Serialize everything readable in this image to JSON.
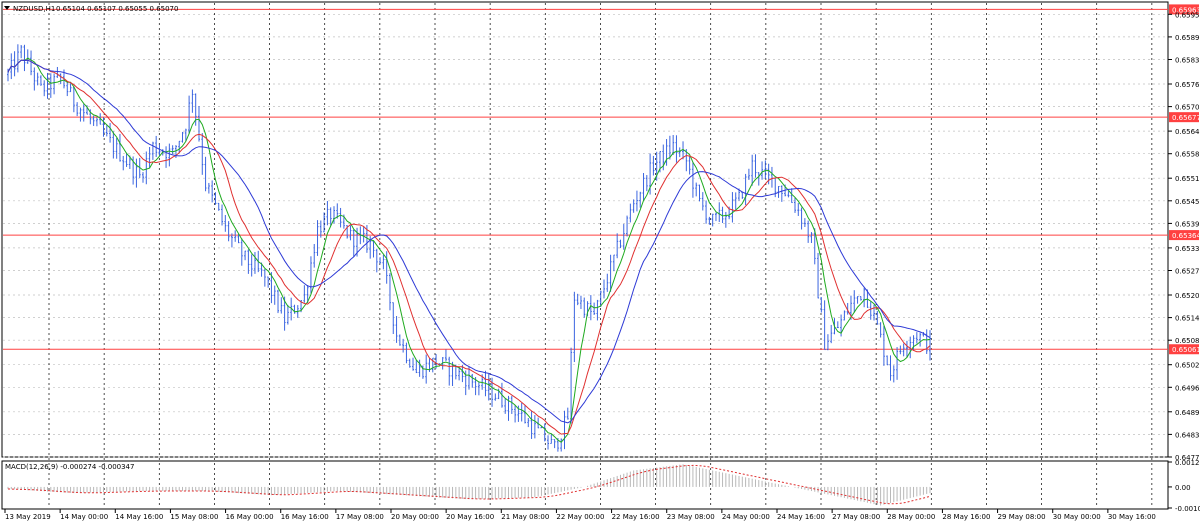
{
  "header": {
    "symbol": "NZDUSD,H1",
    "ohlc": "0.65104 0.65107 0.65055 0.65070"
  },
  "macd_panel": {
    "label": "MACD(12,26,9) -0.000274 -0.000347",
    "ticks": [
      {
        "label": "0.00121",
        "value": 0.00121
      },
      {
        "label": "0.00",
        "value": 0.0
      },
      {
        "label": "-0.001023",
        "value": -0.001023
      }
    ]
  },
  "colors": {
    "background": "#ffffff",
    "candle": "#3a64e0",
    "grid": "#c0c0c0",
    "ma_fast": "#1faa1f",
    "ma_mid": "#e03030",
    "ma_slow": "#2e3ad6",
    "level_line": "#ff4040",
    "macd_hist": "#b8b8b8",
    "macd_signal": "#e03030"
  },
  "chart_data": {
    "type": "candlestick",
    "symbol": "NZDUSD",
    "timeframe": "H1",
    "ylim": [
      0.64775,
      0.6598
    ],
    "y_ticks": [
      "0.65950",
      "0.65890",
      "0.65830",
      "0.65765",
      "0.65705",
      "0.65640",
      "0.65580",
      "0.65515",
      "0.65455",
      "0.65395",
      "0.65330",
      "0.65270",
      "0.65205",
      "0.65145",
      "0.65085",
      "0.65020",
      "0.64960",
      "0.64895",
      "0.64835",
      "0.64775"
    ],
    "x_labels": [
      "13 May 2019",
      "14 May 00:00",
      "14 May 16:00",
      "15 May 08:00",
      "16 May 00:00",
      "16 May 16:00",
      "17 May 08:00",
      "20 May 00:00",
      "20 May 16:00",
      "21 May 08:00",
      "22 May 00:00",
      "22 May 16:00",
      "23 May 08:00",
      "24 May 00:00",
      "24 May 16:00",
      "27 May 08:00",
      "28 May 00:00",
      "28 May 16:00",
      "29 May 08:00",
      "30 May 00:00",
      "30 May 16:00"
    ],
    "horizontal_levels": [
      {
        "label": "0.65963",
        "value": 0.65963
      },
      {
        "label": "0.65677",
        "value": 0.65677
      },
      {
        "label": "0.65364",
        "value": 0.65364
      },
      {
        "label": "0.65061",
        "value": 0.65061
      }
    ],
    "current_price": "0.65070",
    "price_path": [
      [
        0,
        0.6579
      ],
      [
        4,
        0.6585
      ],
      [
        10,
        0.6575
      ],
      [
        16,
        0.6578
      ],
      [
        20,
        0.6572
      ],
      [
        26,
        0.6566
      ],
      [
        32,
        0.656
      ],
      [
        36,
        0.6556
      ],
      [
        40,
        0.6552
      ],
      [
        44,
        0.656
      ],
      [
        50,
        0.6558
      ],
      [
        54,
        0.6566
      ],
      [
        56,
        0.6575
      ],
      [
        60,
        0.655
      ],
      [
        66,
        0.6538
      ],
      [
        72,
        0.653
      ],
      [
        78,
        0.6525
      ],
      [
        84,
        0.6514
      ],
      [
        90,
        0.652
      ],
      [
        94,
        0.6538
      ],
      [
        98,
        0.6542
      ],
      [
        104,
        0.6536
      ],
      [
        110,
        0.6534
      ],
      [
        114,
        0.6528
      ],
      [
        118,
        0.651
      ],
      [
        124,
        0.65
      ],
      [
        130,
        0.6503
      ],
      [
        136,
        0.65
      ],
      [
        142,
        0.6497
      ],
      [
        148,
        0.6494
      ],
      [
        154,
        0.649
      ],
      [
        160,
        0.6485
      ],
      [
        166,
        0.648
      ],
      [
        170,
        0.6488
      ],
      [
        172,
        0.652
      ],
      [
        178,
        0.6515
      ],
      [
        184,
        0.653
      ],
      [
        190,
        0.6545
      ],
      [
        196,
        0.6555
      ],
      [
        202,
        0.656
      ],
      [
        206,
        0.6556
      ],
      [
        210,
        0.6545
      ],
      [
        214,
        0.654
      ],
      [
        218,
        0.6542
      ],
      [
        222,
        0.6546
      ],
      [
        226,
        0.6555
      ],
      [
        230,
        0.6552
      ],
      [
        236,
        0.6548
      ],
      [
        240,
        0.6543
      ],
      [
        244,
        0.6535
      ],
      [
        248,
        0.6508
      ],
      [
        252,
        0.6512
      ],
      [
        256,
        0.6518
      ],
      [
        260,
        0.6522
      ],
      [
        264,
        0.6512
      ],
      [
        268,
        0.65
      ],
      [
        272,
        0.6508
      ],
      [
        276,
        0.651
      ],
      [
        280,
        0.6507
      ]
    ],
    "macd_path": [
      [
        0,
        -0.0001
      ],
      [
        20,
        -0.0003
      ],
      [
        40,
        -0.0002
      ],
      [
        60,
        -0.0002
      ],
      [
        80,
        -0.0004
      ],
      [
        100,
        -0.0002
      ],
      [
        120,
        -0.0004
      ],
      [
        140,
        -0.0006
      ],
      [
        160,
        -0.0005
      ],
      [
        175,
        0.0
      ],
      [
        190,
        0.0008
      ],
      [
        205,
        0.0011
      ],
      [
        220,
        0.0006
      ],
      [
        235,
        0.0001
      ],
      [
        250,
        -0.0004
      ],
      [
        265,
        -0.0009
      ],
      [
        280,
        -0.0003
      ]
    ]
  }
}
